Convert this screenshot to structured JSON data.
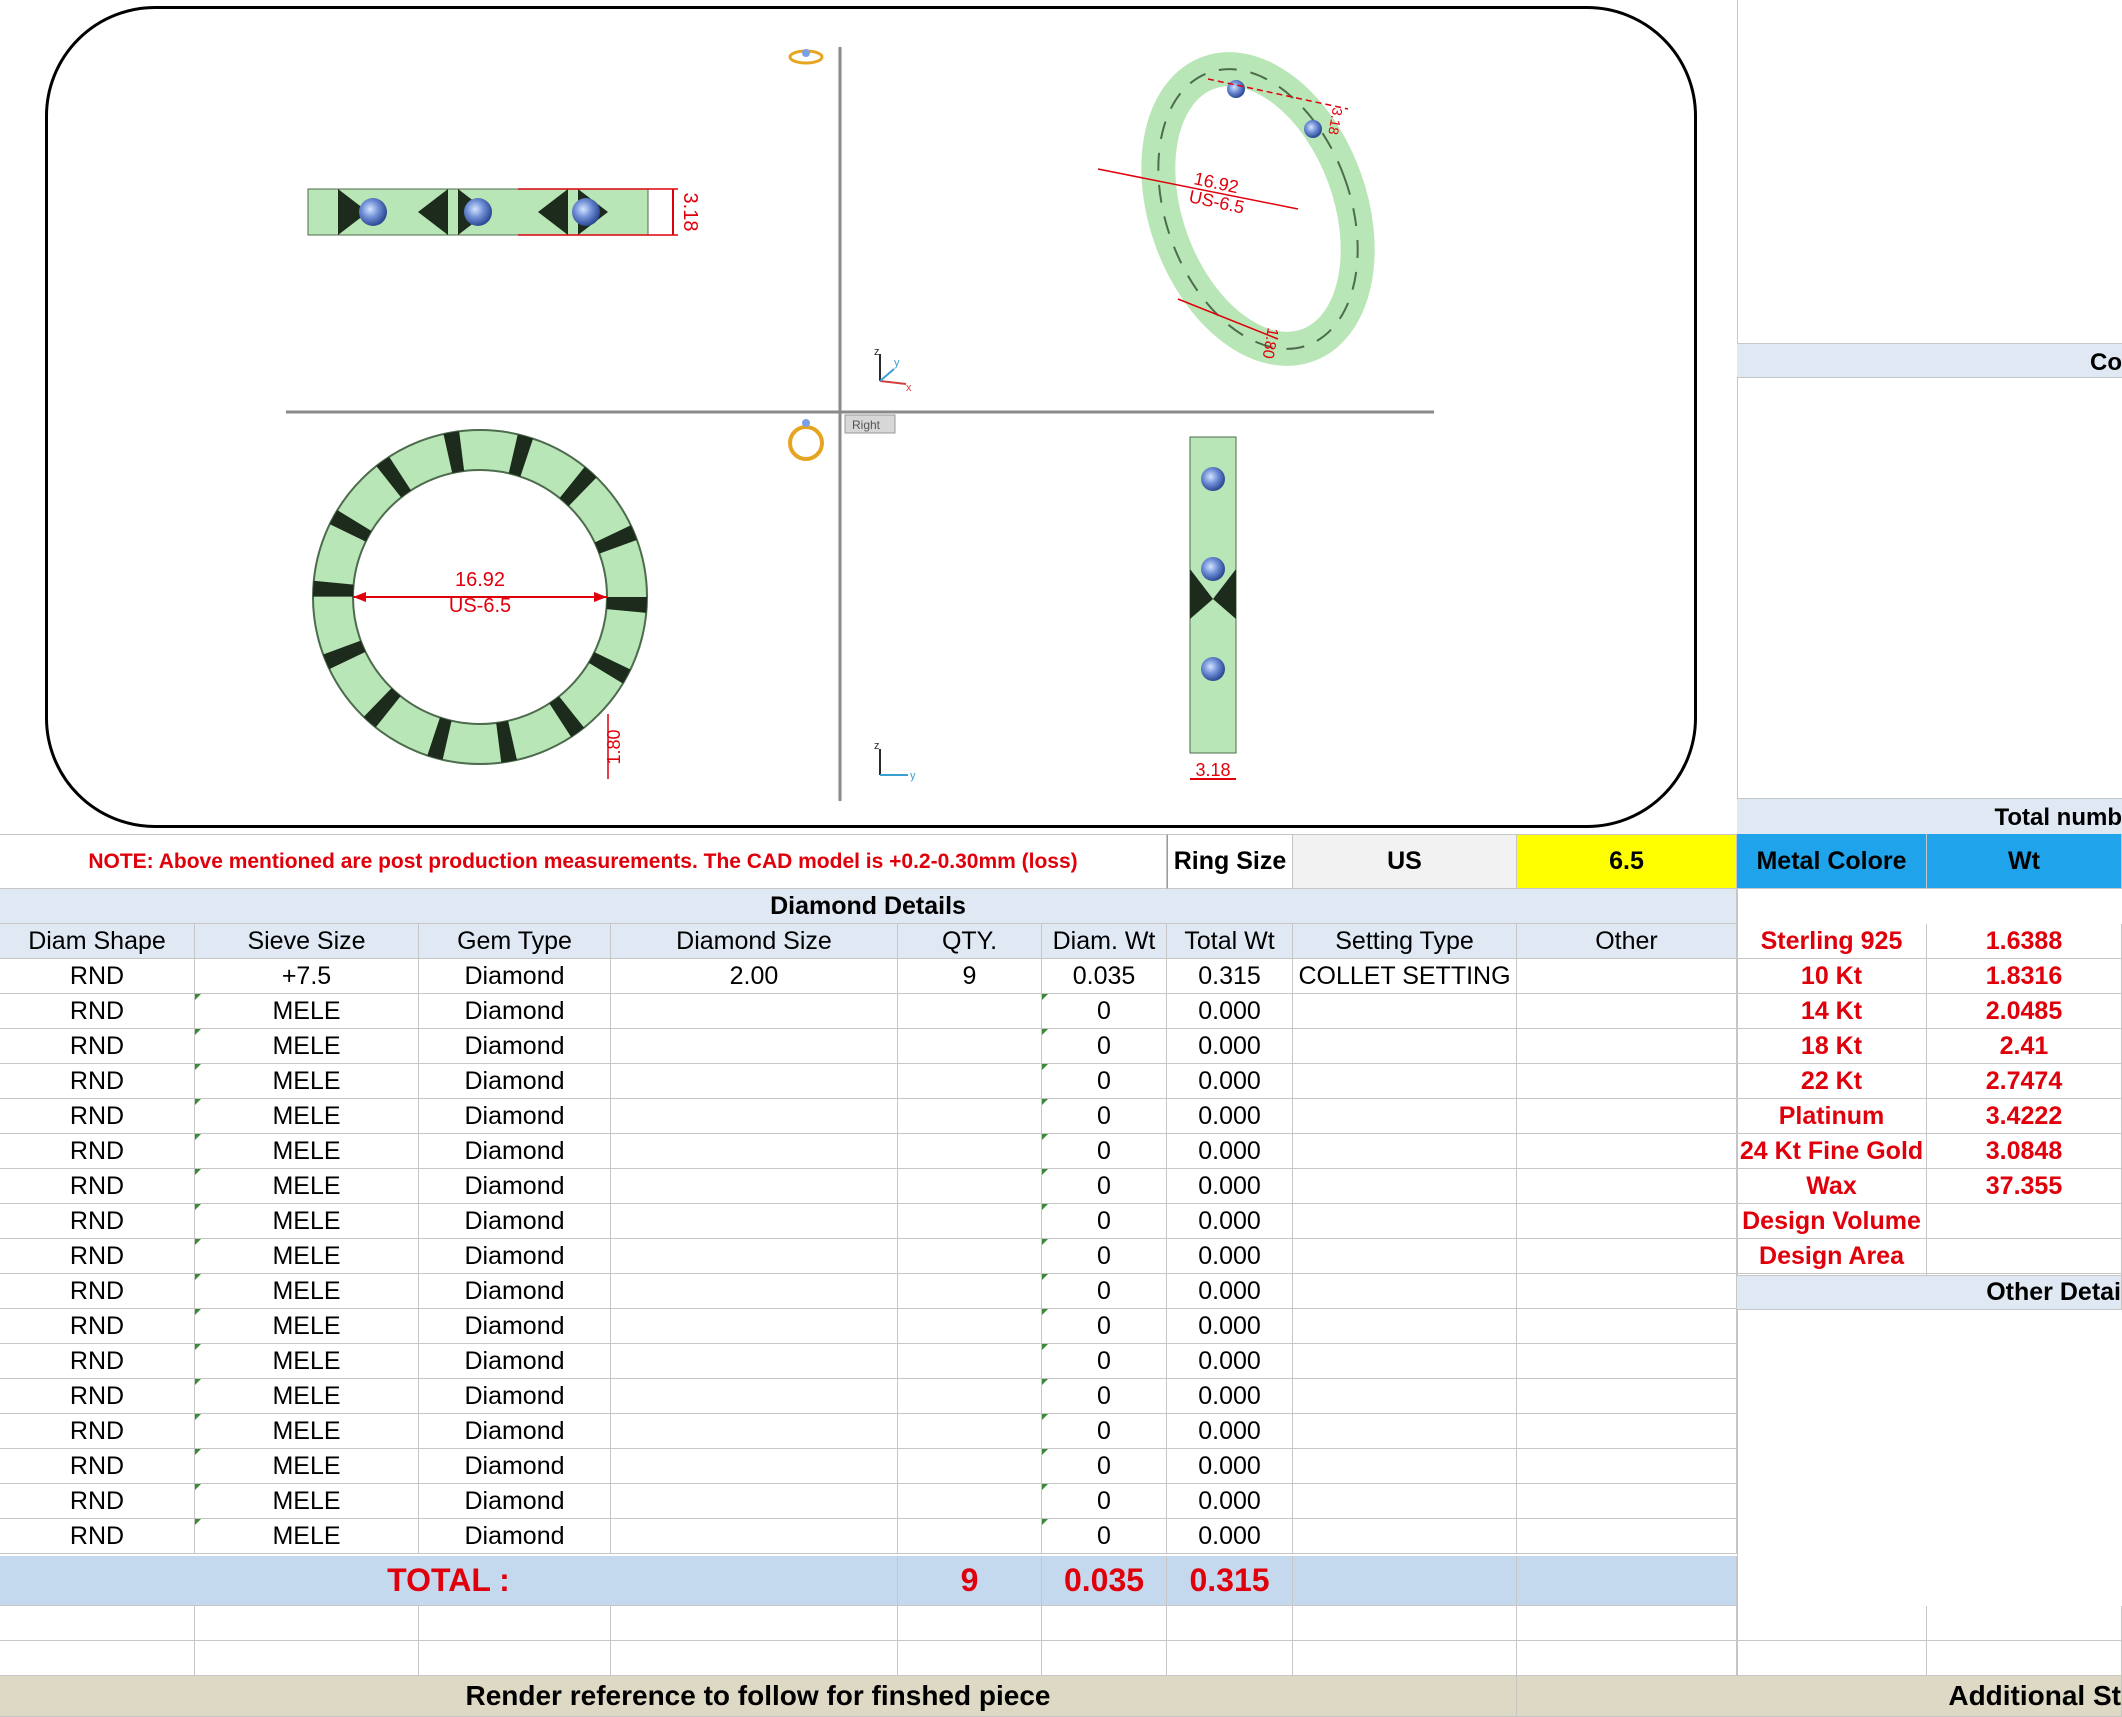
{
  "render": {
    "views": {
      "front_width": "3.18",
      "iso_inner": "16.92",
      "iso_size": "US-6.5",
      "iso_thick": "1.80",
      "iso_width": "3.18",
      "top_inner": "16.92",
      "top_size": "US-6.5",
      "top_thick": "1.80",
      "side_width": "3.18",
      "view_tab": "Right",
      "axis_x": "x",
      "axis_y": "y",
      "axis_z": "z"
    }
  },
  "note": "NOTE: Above mentioned are post production measurements. The CAD model is +0.2-0.30mm (loss)",
  "ring": {
    "label": "Ring Size",
    "system": "US",
    "value": "6.5"
  },
  "diamond_details_title": "Diamond Details",
  "columns": [
    "Diam Shape",
    "Sieve Size",
    "Gem Type",
    "Diamond Size",
    "QTY.",
    "Diam. Wt",
    "Total Wt",
    "Setting Type",
    "Other"
  ],
  "rows": [
    [
      "RND",
      "+7.5",
      "Diamond",
      "2.00",
      "9",
      "0.035",
      "0.315",
      "COLLET SETTING",
      ""
    ],
    [
      "RND",
      "MELE",
      "Diamond",
      "",
      "",
      "0",
      "0.000",
      "",
      ""
    ],
    [
      "RND",
      "MELE",
      "Diamond",
      "",
      "",
      "0",
      "0.000",
      "",
      ""
    ],
    [
      "RND",
      "MELE",
      "Diamond",
      "",
      "",
      "0",
      "0.000",
      "",
      ""
    ],
    [
      "RND",
      "MELE",
      "Diamond",
      "",
      "",
      "0",
      "0.000",
      "",
      ""
    ],
    [
      "RND",
      "MELE",
      "Diamond",
      "",
      "",
      "0",
      "0.000",
      "",
      ""
    ],
    [
      "RND",
      "MELE",
      "Diamond",
      "",
      "",
      "0",
      "0.000",
      "",
      ""
    ],
    [
      "RND",
      "MELE",
      "Diamond",
      "",
      "",
      "0",
      "0.000",
      "",
      ""
    ],
    [
      "RND",
      "MELE",
      "Diamond",
      "",
      "",
      "0",
      "0.000",
      "",
      ""
    ],
    [
      "RND",
      "MELE",
      "Diamond",
      "",
      "",
      "0",
      "0.000",
      "",
      ""
    ],
    [
      "RND",
      "MELE",
      "Diamond",
      "",
      "",
      "0",
      "0.000",
      "",
      ""
    ],
    [
      "RND",
      "MELE",
      "Diamond",
      "",
      "",
      "0",
      "0.000",
      "",
      ""
    ],
    [
      "RND",
      "MELE",
      "Diamond",
      "",
      "",
      "0",
      "0.000",
      "",
      ""
    ],
    [
      "RND",
      "MELE",
      "Diamond",
      "",
      "",
      "0",
      "0.000",
      "",
      ""
    ],
    [
      "RND",
      "MELE",
      "Diamond",
      "",
      "",
      "0",
      "0.000",
      "",
      ""
    ],
    [
      "RND",
      "MELE",
      "Diamond",
      "",
      "",
      "0",
      "0.000",
      "",
      ""
    ],
    [
      "RND",
      "MELE",
      "Diamond",
      "",
      "",
      "0",
      "0.000",
      "",
      ""
    ]
  ],
  "total": {
    "label": "TOTAL :",
    "qty": "9",
    "diam_wt": "0.035",
    "total_wt": "0.315"
  },
  "metal": {
    "header_color": "Metal Colore",
    "header_wt": "Wt",
    "rows": [
      [
        "Sterling 925",
        "1.6388"
      ],
      [
        "10 Kt",
        "1.8316"
      ],
      [
        "14 Kt",
        "2.0485"
      ],
      [
        "18 Kt",
        "2.41"
      ],
      [
        "22 Kt",
        "2.7474"
      ],
      [
        "Platinum",
        "3.4222"
      ],
      [
        "24 Kt Fine Gold",
        "3.0848"
      ],
      [
        "Wax",
        "37.355"
      ],
      [
        "Design Volume",
        ""
      ],
      [
        "Design Area",
        ""
      ]
    ]
  },
  "right_panel": {
    "co": "Co",
    "total_num": "Total numb",
    "other_details": "Other Detai",
    "additional": "Additional St"
  },
  "footer": {
    "render_ref": "Render reference to follow for finshed piece"
  },
  "colors": {
    "metal_green": "#b9e6b6",
    "gem_blue": "#5a7ec8",
    "dim_red": "#e0000b",
    "ring_yellow": "#ffff00",
    "header_blue": "#1fa3ea",
    "total_bg": "#c5d9ee"
  }
}
